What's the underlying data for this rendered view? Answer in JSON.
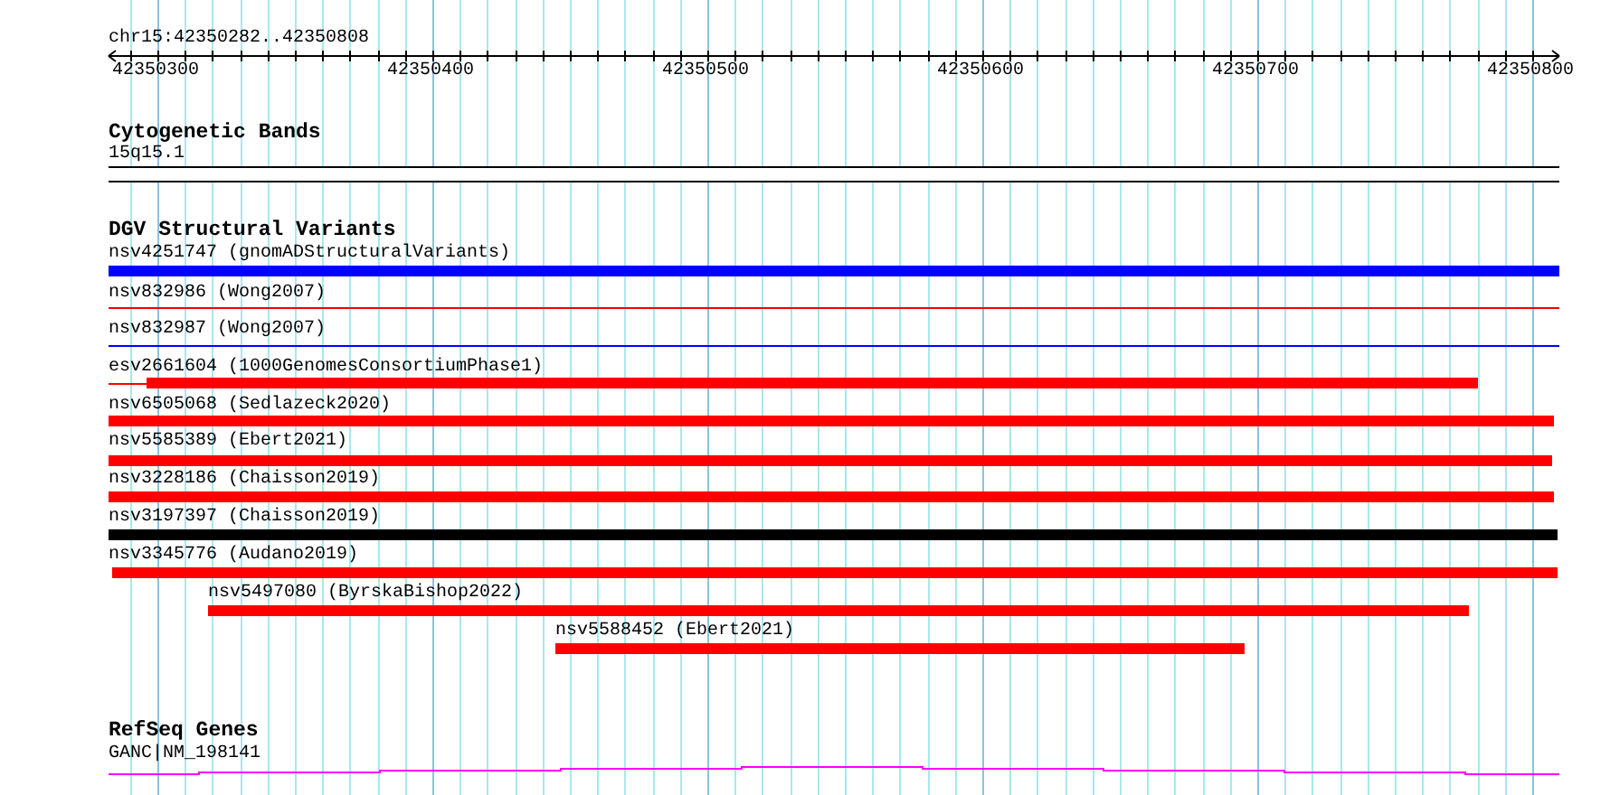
{
  "ruler": {
    "title": "chr15:42350282..42350808",
    "tick_labels": [
      "42350300",
      "42350400",
      "42350500",
      "42350600",
      "42350700",
      "42350800"
    ]
  },
  "tracks": [
    {
      "title": "Cytogenetic Bands",
      "features": [
        {
          "label": "15q15.1",
          "kind": "band",
          "color": "#000000"
        }
      ]
    },
    {
      "title": "DGV Structural Variants",
      "features": [
        {
          "label": "nsv4251747 (gnomADStructuralVariants)",
          "kind": "bar",
          "color": "#0000ff"
        },
        {
          "label": "nsv832986 (Wong2007)",
          "kind": "line",
          "color": "#ff0000"
        },
        {
          "label": "nsv832987 (Wong2007)",
          "kind": "line",
          "color": "#0000ff"
        },
        {
          "label": "esv2661604 (1000GenomesConsortiumPhase1)",
          "kind": "split",
          "color": "#ff0000"
        },
        {
          "label": "nsv6505068 (Sedlazeck2020)",
          "kind": "bar",
          "color": "#ff0000"
        },
        {
          "label": "nsv5585389 (Ebert2021)",
          "kind": "bar",
          "color": "#ff0000"
        },
        {
          "label": "nsv3228186 (Chaisson2019)",
          "kind": "bar",
          "color": "#ff0000"
        },
        {
          "label": "nsv3197397 (Chaisson2019)",
          "kind": "bar",
          "color": "#000000"
        },
        {
          "label": "nsv3345776 (Audano2019)",
          "kind": "bar",
          "color": "#ff0000"
        },
        {
          "label": "nsv5497080 (ByrskaBishop2022)",
          "kind": "bar",
          "color": "#ff0000"
        },
        {
          "label": "nsv5588452 (Ebert2021)",
          "kind": "bar",
          "color": "#ff0000"
        }
      ]
    },
    {
      "title": "RefSeq Genes",
      "features": [
        {
          "label": "GANC|NM_198141",
          "kind": "gene",
          "color": "#ff00ff"
        }
      ]
    }
  ]
}
